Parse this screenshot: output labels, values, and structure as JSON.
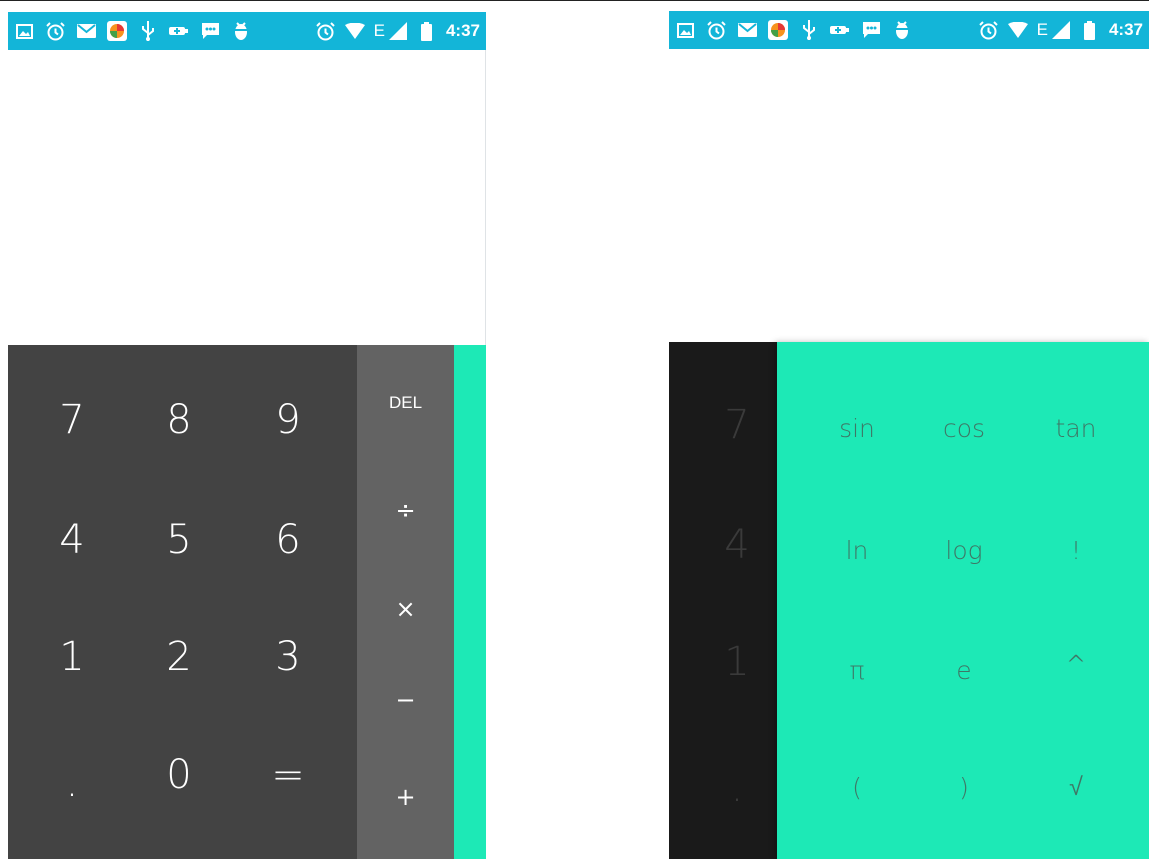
{
  "status_bar": {
    "time": "4:37",
    "network": "E",
    "notification_icons": [
      "image-icon",
      "alarm-icon",
      "mail-icon",
      "app-icon",
      "usb-icon",
      "battery-saver-icon",
      "message-icon",
      "android-debug-icon"
    ],
    "system_icons": [
      "alarm-icon",
      "wifi-icon",
      "signal-icon",
      "battery-icon"
    ],
    "color": "#13b5d8"
  },
  "left_screen": {
    "digits": [
      [
        "7",
        "8",
        "9"
      ],
      [
        "4",
        "5",
        "6"
      ],
      [
        "1",
        "2",
        "3"
      ],
      [
        ".",
        "0",
        "="
      ]
    ],
    "operators": [
      "DEL",
      "÷",
      "×",
      "−",
      "+"
    ],
    "colors": {
      "numpad": "#434343",
      "ops": "#636363",
      "accent": "#1de9b6"
    }
  },
  "right_screen": {
    "digits_visible": [
      "7",
      "4",
      "1",
      "."
    ],
    "advanced": [
      [
        "sin",
        "cos",
        "tan"
      ],
      [
        "ln",
        "log",
        "!"
      ],
      [
        "π",
        "e",
        "^"
      ],
      [
        "(",
        ")",
        "√"
      ]
    ],
    "colors": {
      "numpad": "#1a1a1a",
      "panel": "#1de9b6"
    }
  }
}
